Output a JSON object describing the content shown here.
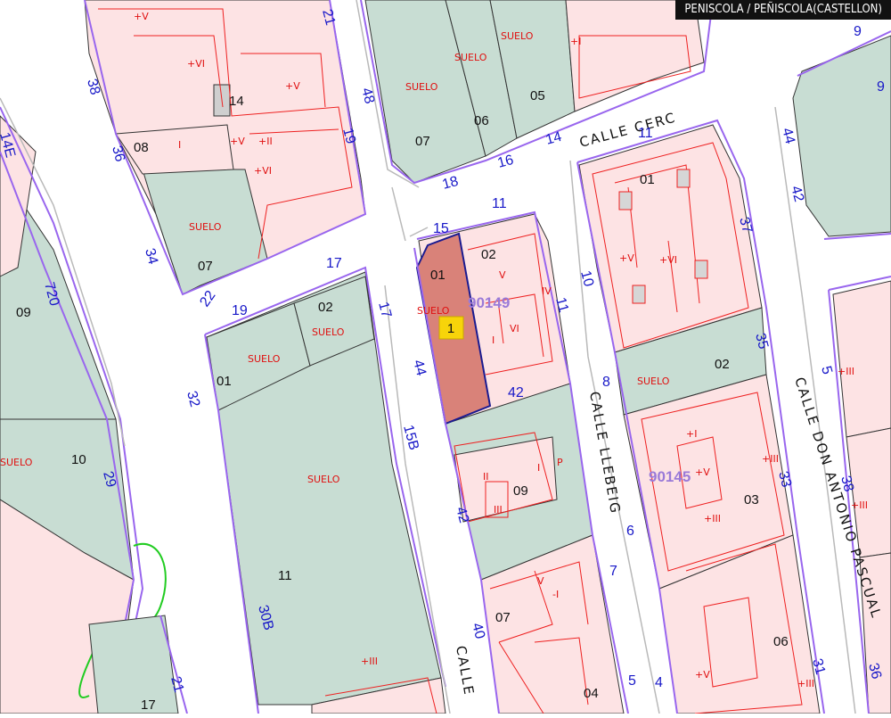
{
  "header": {
    "title": "PENISCOLA / PEÑISCOLA(CASTELLON)"
  },
  "marker": {
    "label": "1"
  },
  "manzanas": {
    "m1": "90149",
    "m2": "90145"
  },
  "streets": {
    "cerc": "CALLE CERC",
    "llebeig": "CALLE LLEBEIG",
    "don_antonio": "CALLE DON ANTONIO PASCUAL",
    "calle_bottom": "CALLE"
  },
  "parcels": {
    "p01_sel": "01",
    "p02_a": "02",
    "p07_a": "07",
    "p06_a": "06",
    "p05_a": "05",
    "p08": "08",
    "p14": "14",
    "p07_b": "07",
    "p09_left": "09",
    "p10": "10",
    "p11_left": "11",
    "p17": "17",
    "p01_mid": "01",
    "p02_mid": "02",
    "p09_mid": "09",
    "p07_mid": "07",
    "p04": "04",
    "p01_right": "01",
    "p02_right": "02",
    "p03": "03",
    "p06_right": "06"
  },
  "red": {
    "suelo": "SUELO",
    "hv": "+V",
    "hvi": "+VI",
    "hi": "+I",
    "hii": "+II",
    "hiii": "+III",
    "i": "I",
    "ii": "II",
    "iii": "III",
    "iv": "IV",
    "v": "V",
    "vi": "VI",
    "m": "-I",
    "p": "P",
    "iiii": "+IIII"
  },
  "numbers": {
    "n38": "38",
    "n36": "36",
    "n34": "34",
    "n32": "32",
    "n29": "29",
    "n30b": "30B",
    "n21": "21",
    "n21b": "21",
    "n48": "48",
    "n19": "19",
    "n19b": "19",
    "n17": "17",
    "n17b": "17",
    "n22": "22",
    "n44": "44",
    "n15b": "15B",
    "n42": "42",
    "n42b": "42",
    "n40": "40",
    "n18": "18",
    "n16": "16",
    "n14": "14",
    "n15": "15",
    "n11": "11",
    "n11b": "11",
    "n11c": "11",
    "n10": "10",
    "n8": "8",
    "n6": "6",
    "n7": "7",
    "n5": "5",
    "n4": "4",
    "n37": "37",
    "n35": "35",
    "n33": "33",
    "n31": "31",
    "n44b": "44",
    "n42c": "42",
    "n9": "9",
    "n9b": "9",
    "n5b": "5",
    "n38b": "38",
    "n36b": "36",
    "n14e": "14E",
    "n720": "720"
  },
  "colors": {
    "green": "#c8ddd3",
    "pink": "#fde3e4",
    "boundary": "#9966ee",
    "building": "#ee2020",
    "selected": "#d98279",
    "marker": "#f7d40a",
    "numbers": "#1818c8"
  }
}
